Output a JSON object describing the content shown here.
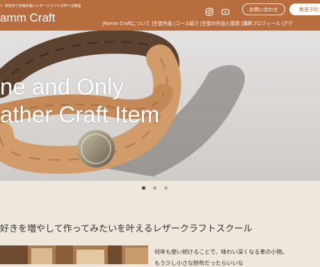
{
  "header": {
    "tagline": "ト 草加市で本格手縫いレザークラフトが学べる教室",
    "logo": "amm Craft",
    "contact_button": "お問い合わせ",
    "class_button": "教室予約",
    "social_icons": [
      "instagram-icon",
      "youtube-icon"
    ]
  },
  "nav": {
    "items": [
      "|Famm Craftについて",
      "|生徒作品",
      "|コース紹介",
      "|生徒の作品と感想",
      "|講師プロフィール",
      "|アク"
    ]
  },
  "hero": {
    "line1": "ne and Only",
    "line2": "ather Craft Item",
    "active_slide": 1,
    "slide_count": 3
  },
  "section": {
    "heading": "好きを増やして作ってみたいを叶えるレザークラフトスクール"
  },
  "intro": {
    "line1": "何年も使い続けることで、味わい深くなる革の小物。",
    "line2": "もう少し小さな財布だったらいいな"
  },
  "colors": {
    "header_bg": "#b86d3f",
    "page_bg": "#efe6dc",
    "dot_active": "#444444",
    "dot_inactive": "#b0aba6"
  }
}
